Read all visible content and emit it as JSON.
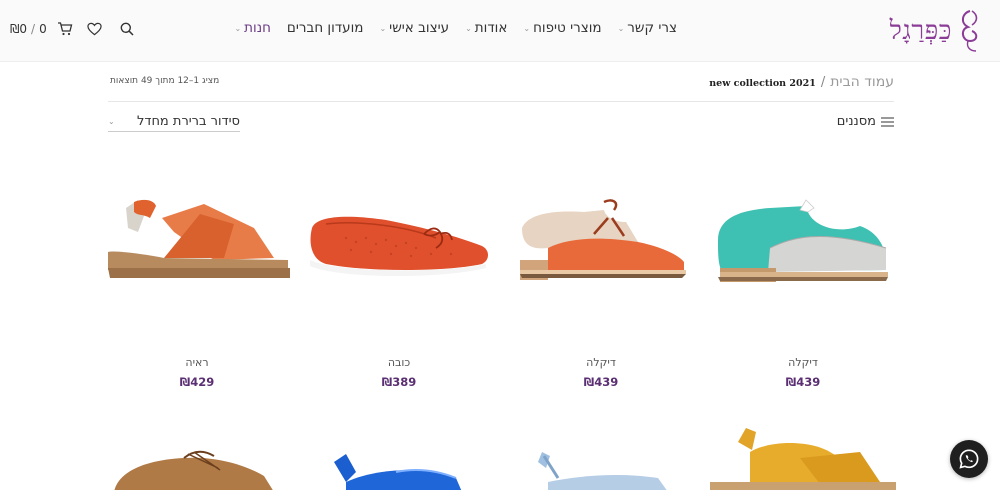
{
  "brand": {
    "name": "כַּפְּרַגָל",
    "color": "#8a3c96"
  },
  "nav": [
    {
      "label": "חנות",
      "has_dropdown": true,
      "active": true
    },
    {
      "label": "מועדון חברים",
      "has_dropdown": false,
      "active": false
    },
    {
      "label": "עיצוב אישי",
      "has_dropdown": true,
      "active": false
    },
    {
      "label": "אודות",
      "has_dropdown": true,
      "active": false
    },
    {
      "label": "מוצרי טיפוח",
      "has_dropdown": true,
      "active": false
    },
    {
      "label": "צרי קשר",
      "has_dropdown": true,
      "active": false
    }
  ],
  "header_tools": {
    "cart_total": "₪0",
    "separator": "/",
    "cart_count": "0",
    "icons": [
      "search-icon",
      "heart-icon",
      "cart-icon"
    ]
  },
  "breadcrumb": {
    "home": "עמוד הבית",
    "separator": "/",
    "current": "new collection 2021"
  },
  "results_text": "מציג 1–12 מתוך 49 תוצאות",
  "filters_label": "מסננים",
  "sort_label": "סידור ברירת מחדל",
  "products": [
    {
      "name": "דיקלה",
      "price": "₪439",
      "image": "teal-grey-oxford-shoe"
    },
    {
      "name": "דיקלה",
      "price": "₪439",
      "image": "beige-orange-laced-shoe"
    },
    {
      "name": "כובה",
      "price": "₪389",
      "image": "orange-perforated-ballet-flat"
    },
    {
      "name": "ראיה",
      "price": "₪429",
      "image": "orange-strap-sandal"
    }
  ],
  "partial_products": [
    {
      "image": "yellow-strap-sandal"
    },
    {
      "image": "light-blue-sandal"
    },
    {
      "image": "blue-patent-sandal"
    },
    {
      "image": "brown-laced-shoe"
    }
  ],
  "colors": {
    "accent": "#5b2f73",
    "whatsapp_bg": "#1f1f1f"
  }
}
